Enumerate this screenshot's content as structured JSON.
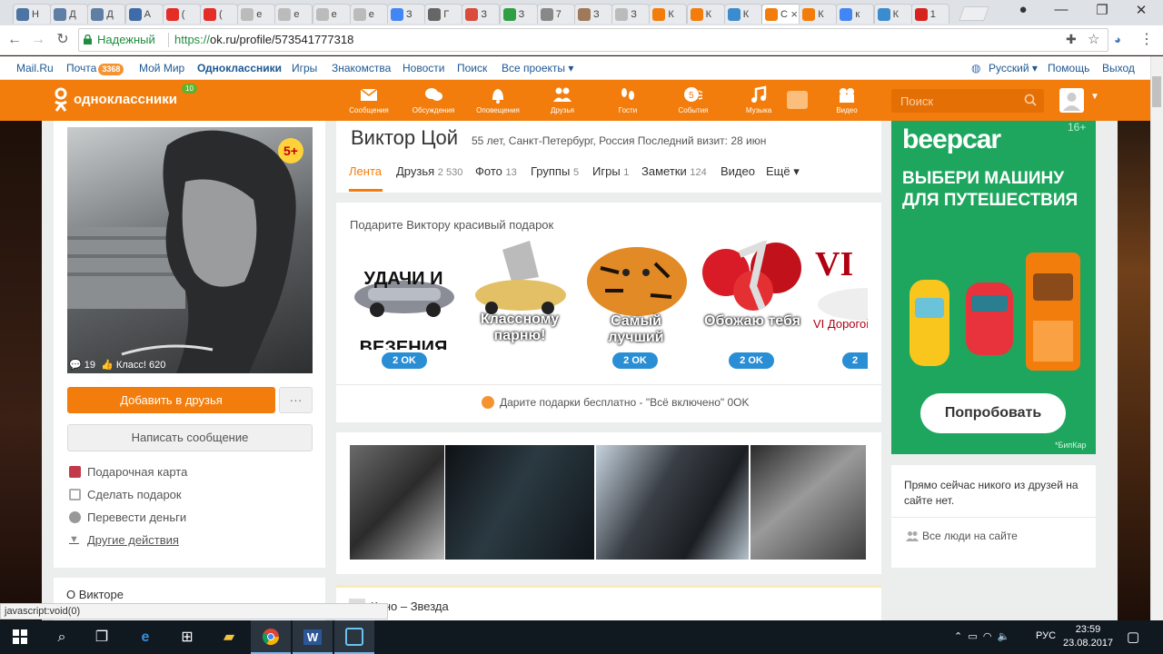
{
  "browser": {
    "tabs": [
      {
        "fav": "VK",
        "letter": "Н",
        "color": "#4c75a3"
      },
      {
        "fav": "mail",
        "letter": "Д",
        "color": "#5f7ea3"
      },
      {
        "fav": "mail",
        "letter": "Д",
        "color": "#5f7ea3"
      },
      {
        "fav": "bars",
        "letter": "А",
        "color": "#3d6ca8"
      },
      {
        "fav": "yt",
        "letter": "(",
        "color": "#e52d27"
      },
      {
        "fav": "yt",
        "letter": "(",
        "color": "#e52d27"
      },
      {
        "fav": "doc",
        "letter": "е",
        "color": "#bbb"
      },
      {
        "fav": "doc",
        "letter": "е",
        "color": "#bbb"
      },
      {
        "fav": "doc",
        "letter": "е",
        "color": "#bbb"
      },
      {
        "fav": "doc",
        "letter": "е",
        "color": "#bbb"
      },
      {
        "fav": "G",
        "letter": "З",
        "color": "#4285f4"
      },
      {
        "fav": "V",
        "letter": "Г",
        "color": "#666"
      },
      {
        "fav": "v",
        "letter": "З",
        "color": "#d94b3b"
      },
      {
        "fav": "arrow",
        "letter": "З",
        "color": "#2ea043"
      },
      {
        "fav": "ША",
        "letter": "7",
        "color": "#888"
      },
      {
        "fav": "face",
        "letter": "З",
        "color": "#a0785a"
      },
      {
        "fav": "page",
        "letter": "З",
        "color": "#bbb"
      },
      {
        "fav": "OK",
        "letter": "К",
        "color": "#f27d0c"
      },
      {
        "fav": "OK",
        "letter": "К",
        "color": "#f27d0c"
      },
      {
        "fav": "bird",
        "letter": "К",
        "color": "#3b8ccf"
      },
      {
        "fav": "ok",
        "letter": "С",
        "color": "#f27d0c",
        "active": true
      },
      {
        "fav": "ok",
        "letter": "К",
        "color": "#f27d0c"
      },
      {
        "fav": "G",
        "letter": "к",
        "color": "#4285f4"
      },
      {
        "fav": "bird",
        "letter": "К",
        "color": "#3b8ccf"
      },
      {
        "fav": "c",
        "letter": "1",
        "color": "#d6231d"
      }
    ],
    "secure_label": "Надежный",
    "url_scheme": "https://",
    "url_rest": "ok.ru/profile/573541777318",
    "status_text": "javascript:void(0)"
  },
  "portal": {
    "mailru": "Mail.Ru",
    "pochta": "Почта",
    "pochta_count": "3368",
    "moy_mir": "Мой Мир",
    "odnoklassniki": "Одноклассники",
    "igry": "Игры",
    "znakomstva": "Знакомства",
    "novosti": "Новости",
    "poisk": "Поиск",
    "vse_proekty": "Все проекты ▾",
    "lang": "Русский ▾",
    "pomosch": "Помощь",
    "vyhod": "Выход"
  },
  "header": {
    "logo_text": "одноклассники",
    "logo_badge": "10",
    "nav": [
      {
        "icon": "envelope-icon",
        "label": "Сообщения"
      },
      {
        "icon": "chat-icon",
        "label": "Обсуждения"
      },
      {
        "icon": "bell-icon",
        "label": "Оповещения"
      },
      {
        "icon": "friends-icon",
        "label": "Друзья"
      },
      {
        "icon": "footprints-icon",
        "label": "Гости"
      },
      {
        "icon": "events-icon",
        "label": "События"
      },
      {
        "icon": "music-icon",
        "label": "Музыка"
      },
      {
        "icon": "video-icon",
        "label": "Видео"
      }
    ],
    "search_placeholder": "Поиск"
  },
  "profile": {
    "name": "Виктор Цой",
    "info": "55 лет, Санкт-Петербург, Россия  Последний визит: 28 июн",
    "age_badge": "5+",
    "photo_comments": "19",
    "photo_likes": "Класс! 620",
    "add_friend": "Добавить в друзья",
    "more_btn": "···",
    "write_msg": "Написать сообщение",
    "actions": [
      {
        "icon": "gift-card-icon",
        "label": "Подарочная карта"
      },
      {
        "icon": "gift-icon",
        "label": "Сделать подарок"
      },
      {
        "icon": "money-icon",
        "label": "Перевести деньги"
      },
      {
        "icon": "triangle-icon",
        "label": "Другие действия"
      }
    ],
    "about": "О Викторе",
    "tabs": [
      {
        "label": "Лента",
        "count": ""
      },
      {
        "label": "Друзья",
        "count": "2 530"
      },
      {
        "label": "Фото",
        "count": "13"
      },
      {
        "label": "Группы",
        "count": "5"
      },
      {
        "label": "Игры",
        "count": "1"
      },
      {
        "label": "Заметки",
        "count": "124"
      },
      {
        "label": "Видео",
        "count": ""
      },
      {
        "label": "Ещё ▾",
        "count": ""
      }
    ]
  },
  "gifts": {
    "title": "Подарите Виктору красивый подарок",
    "items": [
      {
        "text": "УДАЧИ И ВЕЗЕНИЯ",
        "price": "2 OK"
      },
      {
        "text": "Классному парню!",
        "price": ""
      },
      {
        "text": "Самый лучший",
        "price": "2 OK"
      },
      {
        "text": "Обожаю тебя",
        "price": "2 OK"
      },
      {
        "text": "VI Дорогой",
        "price": "2"
      }
    ],
    "free_text": "Дарите подарки бесплатно - \"Всё включено\" 0OK"
  },
  "music": {
    "track": "Кино – Звезда"
  },
  "ad": {
    "logo": "beepcar",
    "age": "16+",
    "text": "ВЫБЕРИ МАШИНУ ДЛЯ ПУТЕШЕСТВИЯ",
    "button": "Попробовать",
    "source": "*БипКар"
  },
  "online": {
    "text": "Прямо сейчас никого из друзей на сайте нет.",
    "all_people": "Все люди на сайте"
  },
  "taskbar": {
    "lang": "РУС",
    "time": "23:59",
    "date": "23.08.2017"
  }
}
